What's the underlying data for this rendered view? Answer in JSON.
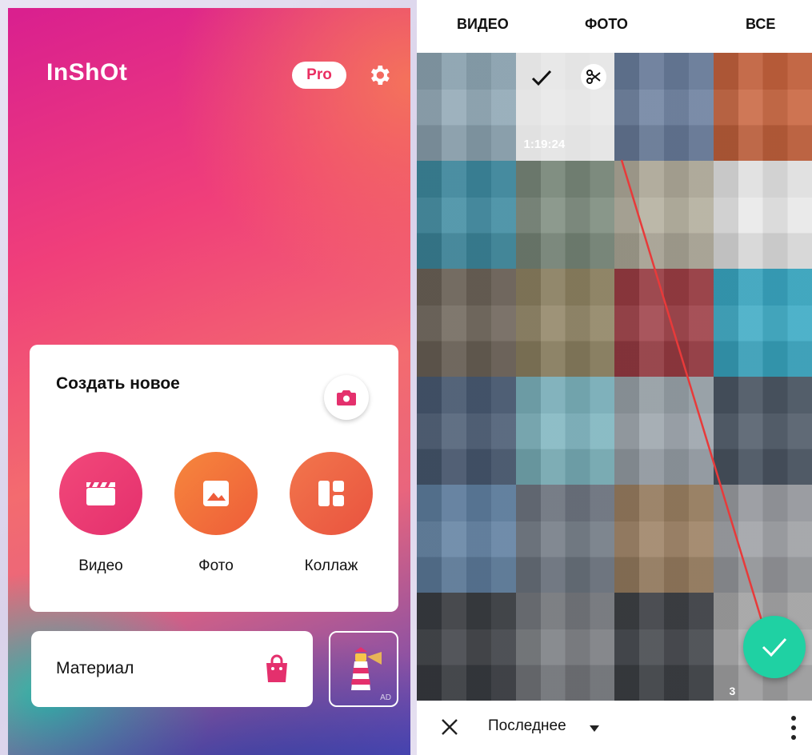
{
  "left": {
    "logo": "InShOt",
    "pro_badge": "Pro",
    "create_card": {
      "title": "Создать новое",
      "actions": [
        {
          "label": "Видео",
          "icon": "clapperboard-icon",
          "color": "#e4306d"
        },
        {
          "label": "Фото",
          "icon": "image-icon",
          "color": "#ee5c3a"
        },
        {
          "label": "Коллаж",
          "icon": "collage-layout-icon",
          "color": "#e9533f"
        }
      ]
    },
    "material": {
      "label": "Материал",
      "icon": "shopping-bag-icon"
    },
    "ad": {
      "label": "AD",
      "icon": "lighthouse-icon"
    }
  },
  "right": {
    "tabs": [
      "ВИДЕО",
      "ФОТО",
      "ВСЕ"
    ],
    "selected_item": {
      "duration": "1:19:24"
    },
    "last_item_count": "3",
    "bottom": {
      "folder": "Последнее"
    },
    "accent": "#1fd1a3",
    "thumb_colors": [
      "#8fa7b5",
      "#cfcfcf",
      "#6b7f9e",
      "#c8643e",
      "#3e8aa0",
      "#7b8a7c",
      "#b2ad9c",
      "#e8e8e8",
      "#6c6358",
      "#8f8363",
      "#9c3d44",
      "#3aa9c4",
      "#495a72",
      "#7db4be",
      "#9aa3aa",
      "#4d5866",
      "#5f7fa0",
      "#6f7782",
      "#9b8062",
      "#9c9ea3",
      "#3a3d42",
      "#777a7f",
      "#3f4247",
      "#a9a9aa"
    ]
  }
}
